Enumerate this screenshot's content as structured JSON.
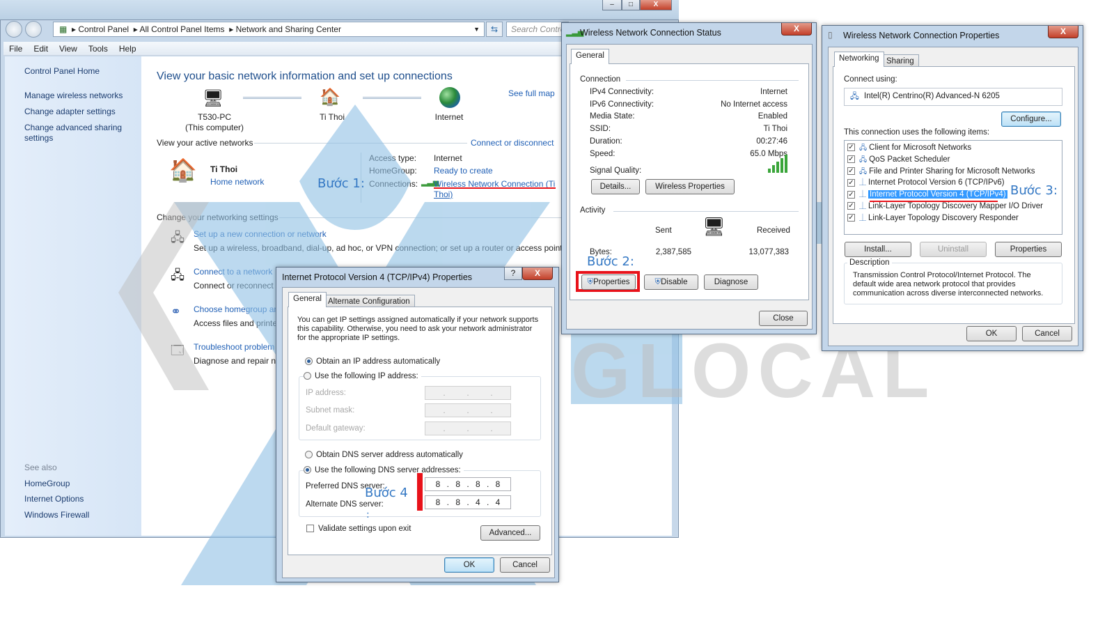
{
  "explorer": {
    "address": [
      "Control Panel",
      "All Control Panel Items",
      "Network and Sharing Center"
    ],
    "search_placeholder": "Search Control Panel",
    "menu": [
      "File",
      "Edit",
      "View",
      "Tools",
      "Help"
    ],
    "caption_buttons": {
      "minimize": "–",
      "maximize": "□",
      "close": "X"
    },
    "sidebar": {
      "home": "Control Panel Home",
      "items": [
        "Manage wireless networks",
        "Change adapter settings",
        "Change advanced sharing settings"
      ],
      "see_also_label": "See also",
      "see_also": [
        "HomeGroup",
        "Internet Options",
        "Windows Firewall"
      ]
    },
    "main": {
      "title": "View your basic network information and set up connections",
      "see_full_map": "See full map",
      "map": {
        "computer": "T530-PC",
        "computer_sub": "(This computer)",
        "network": "Ti Thoi",
        "internet": "Internet"
      },
      "active_networks_label": "View your active networks",
      "connect_disconnect": "Connect or disconnect",
      "network_name": "Ti Thoi",
      "network_type": "Home network",
      "access_type_label": "Access type:",
      "access_type": "Internet",
      "homegroup_label": "HomeGroup:",
      "homegroup": "Ready to create",
      "connections_label": "Connections:",
      "connection_link": "Wireless Network Connection (Ti Thoi)",
      "change_settings_label": "Change your networking settings",
      "tasks": [
        {
          "link": "Set up a new connection or network",
          "desc": "Set up a wireless, broadband, dial-up, ad hoc, or VPN connection; or set up a router or access point."
        },
        {
          "link": "Connect to a network",
          "desc": "Connect or reconnect"
        },
        {
          "link": "Choose homegroup ar",
          "desc": "Access files and printe"
        },
        {
          "link": "Troubleshoot problem",
          "desc": "Diagnose and repair ne"
        }
      ]
    }
  },
  "status_dialog": {
    "title": "Wireless Network Connection Status",
    "tab": "General",
    "connection_label": "Connection",
    "rows": [
      {
        "label": "IPv4 Connectivity:",
        "value": "Internet"
      },
      {
        "label": "IPv6 Connectivity:",
        "value": "No Internet access"
      },
      {
        "label": "Media State:",
        "value": "Enabled"
      },
      {
        "label": "SSID:",
        "value": "Ti Thoi"
      },
      {
        "label": "Duration:",
        "value": "00:27:46"
      },
      {
        "label": "Speed:",
        "value": "65.0 Mbps"
      }
    ],
    "signal_label": "Signal Quality:",
    "signal_bars": 5,
    "details_btn": "Details...",
    "wireless_props_btn": "Wireless Properties",
    "activity_label": "Activity",
    "sent_label": "Sent",
    "received_label": "Received",
    "bytes_label": "Bytes:",
    "bytes_sent": "2,387,585",
    "bytes_received": "13,077,383",
    "properties_btn": "Properties",
    "disable_btn": "Disable",
    "diagnose_btn": "Diagnose",
    "close_btn": "Close"
  },
  "props_dialog": {
    "title": "Wireless Network Connection Properties",
    "tabs": [
      "Networking",
      "Sharing"
    ],
    "connect_using_label": "Connect using:",
    "adapter": "Intel(R) Centrino(R) Advanced-N 6205",
    "configure_btn": "Configure...",
    "items_label": "This connection uses the following items:",
    "items": [
      {
        "label": "Client for Microsoft Networks",
        "checked": true
      },
      {
        "label": "QoS Packet Scheduler",
        "checked": true
      },
      {
        "label": "File and Printer Sharing for Microsoft Networks",
        "checked": true
      },
      {
        "label": "Internet Protocol Version 6 (TCP/IPv6)",
        "checked": true
      },
      {
        "label": "Internet Protocol Version 4 (TCP/IPv4)",
        "checked": true,
        "selected": true
      },
      {
        "label": "Link-Layer Topology Discovery Mapper I/O Driver",
        "checked": true
      },
      {
        "label": "Link-Layer Topology Discovery Responder",
        "checked": true
      }
    ],
    "install_btn": "Install...",
    "uninstall_btn": "Uninstall",
    "properties_btn": "Properties",
    "description_label": "Description",
    "description": "Transmission Control Protocol/Internet Protocol. The default wide area network protocol that provides communication across diverse interconnected networks.",
    "ok_btn": "OK",
    "cancel_btn": "Cancel"
  },
  "ipv4_dialog": {
    "title": "Internet Protocol Version 4 (TCP/IPv4) Properties",
    "help": "?",
    "tabs": [
      "General",
      "Alternate Configuration"
    ],
    "intro": "You can get IP settings assigned automatically if your network supports this capability. Otherwise, you need to ask your network administrator for the appropriate IP settings.",
    "obtain_ip_auto": "Obtain an IP address automatically",
    "use_ip": "Use the following IP address:",
    "ip_label": "IP address:",
    "subnet_label": "Subnet mask:",
    "gateway_label": "Default gateway:",
    "obtain_dns_auto": "Obtain DNS server address automatically",
    "use_dns": "Use the following DNS server addresses:",
    "preferred_label": "Preferred DNS server:",
    "preferred": [
      "8",
      "8",
      "8",
      "8"
    ],
    "alternate_label": "Alternate DNS server:",
    "alternate": [
      "8",
      "8",
      "4",
      "4"
    ],
    "validate": "Validate settings upon exit",
    "advanced_btn": "Advanced...",
    "ok_btn": "OK",
    "cancel_btn": "Cancel",
    "ip_selected": "auto",
    "dns_selected": "manual",
    "validate_checked": false
  },
  "annotations": {
    "step1": "Bước 1:",
    "step2": "Bước 2:",
    "step3": "Bước 3:",
    "step4": "Bước 4",
    "colon": ":",
    "highlight_color": "#e8121a",
    "step_color": "#3478c4"
  },
  "watermark": {
    "text": "GLOCAL"
  }
}
